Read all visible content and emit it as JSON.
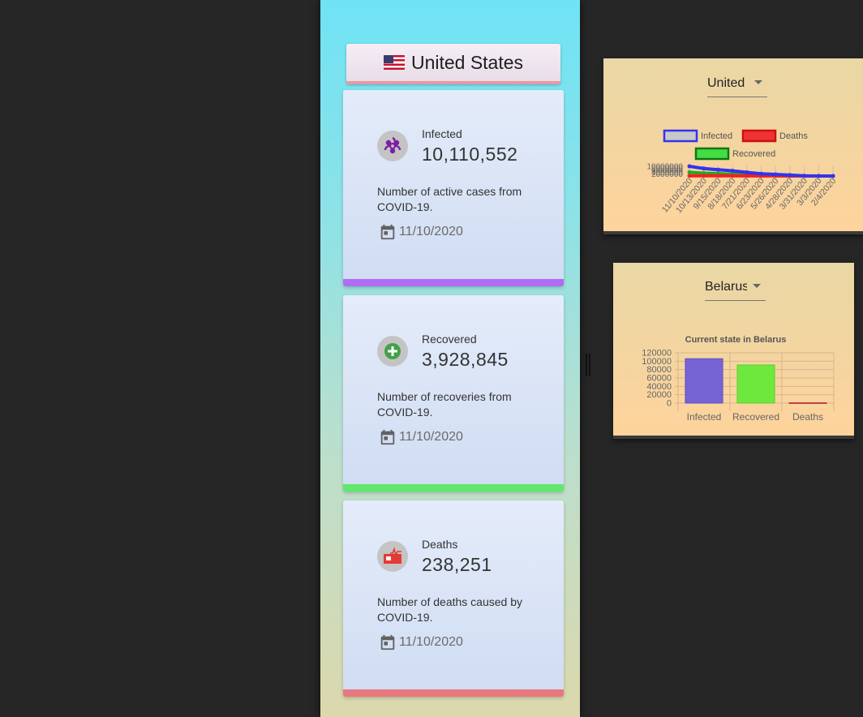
{
  "country": {
    "name": "United States",
    "flag_icon": "us-flag-icon"
  },
  "cards": [
    {
      "label": "Infected",
      "value": "10,110,552",
      "description": "Number of active cases from COVID-19.",
      "date": "11/10/2020",
      "icon": "biohazard-icon",
      "bar_color": "#b06cf2",
      "icon_color": "#7b1fa2"
    },
    {
      "label": "Recovered",
      "value": "3,928,845",
      "description": "Number of recoveries from COVID-19.",
      "date": "11/10/2020",
      "icon": "plus-circle-icon",
      "bar_color": "#5fe86a",
      "icon_color": "#43a047"
    },
    {
      "label": "Deaths",
      "value": "238,251",
      "description": "Number of deaths caused by COVID-19.",
      "date": "11/10/2020",
      "icon": "heart-monitor-icon",
      "bar_color": "#e87780",
      "icon_color": "#e53935"
    }
  ],
  "history_panel": {
    "select_value": "United"
  },
  "bar_panel": {
    "select_value": "Belarus"
  },
  "chart_data": [
    {
      "type": "line",
      "legend": [
        "Infected",
        "Deaths",
        "Recovered"
      ],
      "legend_colors": {
        "Infected": "#3333ee",
        "Deaths": "#ee2222",
        "Recovered": "#22aa22"
      },
      "x_tick_labels": [
        "11/10/2020",
        "10/13/2020",
        "9/15/2020",
        "8/18/2020",
        "7/21/2020",
        "6/23/2020",
        "5/26/2020",
        "4/28/2020",
        "3/31/2020",
        "3/3/2020",
        "2/4/2020"
      ],
      "y_tick_labels": [
        "10000000",
        "8000000",
        "6000000",
        "4000000",
        "2000000"
      ],
      "series": [
        {
          "name": "Infected",
          "color": "#3333ee",
          "values": [
            10110552,
            7800000,
            6550000,
            5400000,
            3800000,
            2350000,
            1650000,
            1000000,
            180000,
            100,
            11
          ]
        },
        {
          "name": "Recovered",
          "color": "#22aa22",
          "values": [
            3928845,
            3000000,
            2500000,
            1850000,
            1150000,
            640000,
            380000,
            120000,
            7000,
            7,
            0
          ]
        },
        {
          "name": "Deaths",
          "color": "#ee2222",
          "values": [
            238251,
            215000,
            195000,
            172000,
            140000,
            121000,
            98000,
            58000,
            4000,
            6,
            0
          ]
        }
      ]
    },
    {
      "type": "bar",
      "title": "Current state in Belarus",
      "categories": [
        "Infected",
        "Recovered",
        "Deaths"
      ],
      "values": [
        106000,
        91000,
        950
      ],
      "colors": [
        "#7664d4",
        "#6fe83e",
        "#e06060"
      ],
      "ylim": [
        0,
        120000
      ],
      "y_tick_labels": [
        "120000",
        "100000",
        "80000",
        "60000",
        "40000",
        "20000",
        "0"
      ]
    }
  ]
}
